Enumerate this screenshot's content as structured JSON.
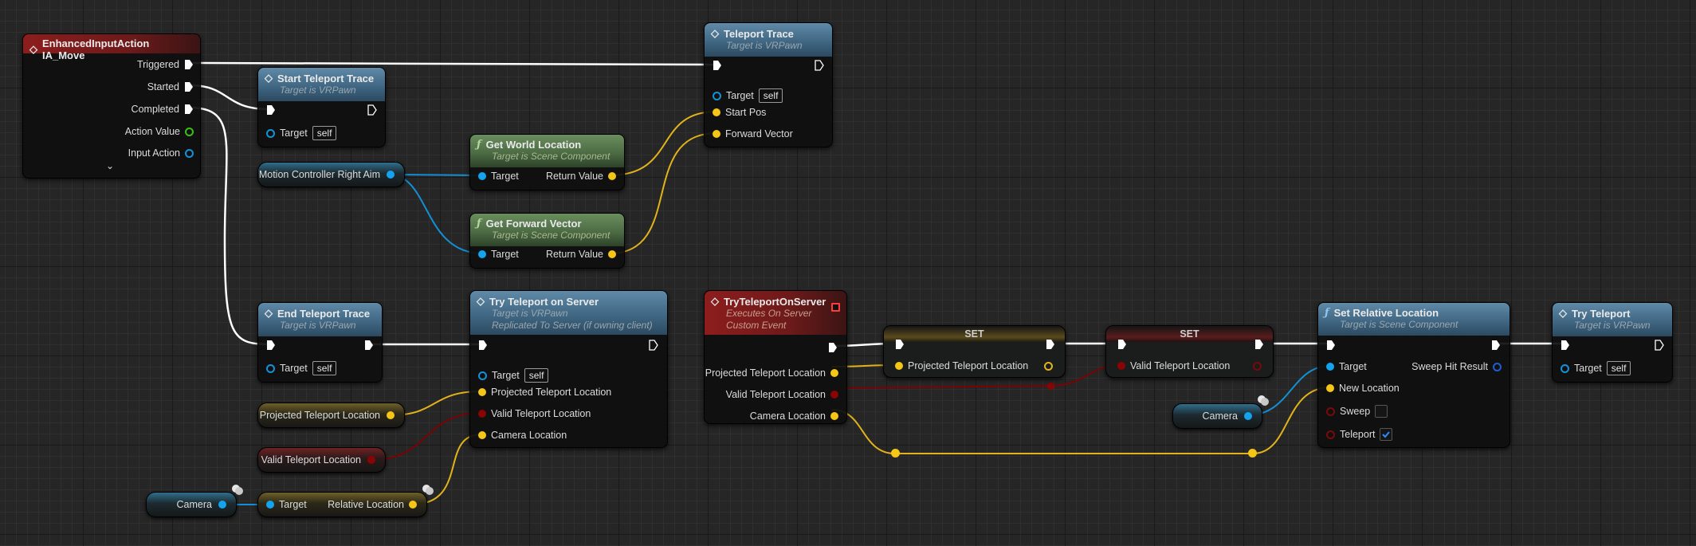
{
  "graph": {
    "colors": {
      "exec_wire": "#ffffff",
      "vector_pin": "#f5c518",
      "object_pin": "#14a3ee",
      "bool_pin": "#8a0404",
      "background": "#262626"
    },
    "nodes": {
      "ia_move": {
        "title": "EnhancedInputAction IA_Move",
        "pins": [
          "Triggered",
          "Started",
          "Completed",
          "Action Value",
          "Input Action"
        ],
        "expand_icon": "chevron-down-icon"
      },
      "start_teleport_trace": {
        "title": "Start Teleport Trace",
        "subtitle": "Target is VRPawn",
        "target_label": "Target",
        "target_value": "self"
      },
      "teleport_trace": {
        "title": "Teleport Trace",
        "subtitle": "Target is VRPawn",
        "target_label": "Target",
        "target_value": "self",
        "pins": [
          "Start Pos",
          "Forward Vector"
        ]
      },
      "get_world_location": {
        "title": "Get World Location",
        "subtitle": "Target is Scene Component",
        "in": "Target",
        "out": "Return Value"
      },
      "get_forward_vector": {
        "title": "Get Forward Vector",
        "subtitle": "Target is Scene Component",
        "in": "Target",
        "out": "Return Value"
      },
      "motion_controller_var": {
        "label": "Motion Controller Right Aim"
      },
      "end_teleport_trace": {
        "title": "End Teleport Trace",
        "subtitle": "Target is VRPawn",
        "target_label": "Target",
        "target_value": "self"
      },
      "try_teleport_on_server_call": {
        "title": "Try Teleport on Server",
        "subtitle1": "Target is VRPawn",
        "subtitle2": "Replicated To Server (if owning client)",
        "target_label": "Target",
        "target_value": "self",
        "pins": [
          "Projected Teleport Location",
          "Valid Teleport Location",
          "Camera Location"
        ]
      },
      "projected_var": {
        "label": "Projected Teleport Location"
      },
      "valid_var": {
        "label": "Valid Teleport Location"
      },
      "camera_var_1": {
        "label": "Camera"
      },
      "relative_location": {
        "in": "Target",
        "out": "Relative Location"
      },
      "try_teleport_on_server_event": {
        "title": "TryTeleportOnServer",
        "subtitle1": "Executes On Server",
        "subtitle2": "Custom Event",
        "pins": [
          "Projected Teleport Location",
          "Valid Teleport Location",
          "Camera Location"
        ]
      },
      "set_projected": {
        "title": "SET",
        "pin": "Projected Teleport Location"
      },
      "set_valid": {
        "title": "SET",
        "pin": "Valid Teleport Location"
      },
      "camera_var_2": {
        "label": "Camera"
      },
      "set_relative_location": {
        "title": "Set Relative Location",
        "subtitle": "Target is Scene Component",
        "pins_in": [
          "Target",
          "New Location",
          "Sweep",
          "Teleport"
        ],
        "pin_out": "Sweep Hit Result",
        "sweep_checked": false,
        "teleport_checked": true
      },
      "try_teleport": {
        "title": "Try Teleport",
        "subtitle": "Target is VRPawn",
        "target_label": "Target",
        "target_value": "self"
      }
    }
  }
}
